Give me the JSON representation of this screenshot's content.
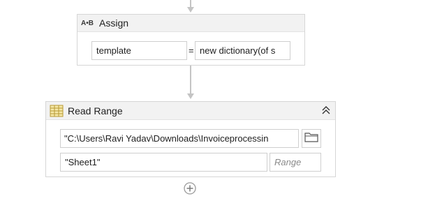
{
  "assign": {
    "title": "Assign",
    "icon_glyph": "A•B",
    "icon": "assign-icon",
    "left_value": "template",
    "operator": "=",
    "right_value": "new dictionary(of s"
  },
  "read_range": {
    "title": "Read Range",
    "icon": "spreadsheet-icon",
    "collapse_icon": "chevron-double-up-icon",
    "workbook_path": "\"C:\\Users\\Ravi Yadav\\Downloads\\Invoiceprocessin",
    "browse_icon": "folder-icon",
    "sheet_name": "\"Sheet1\"",
    "range_placeholder": "Range"
  },
  "add_activity_icon": "add-circle-icon",
  "colors": {
    "connector": "#c4c4c4",
    "header_bg": "#f2f2f2",
    "border": "#d6d6d6",
    "spreadsheet_icon": "#c8b04a"
  }
}
